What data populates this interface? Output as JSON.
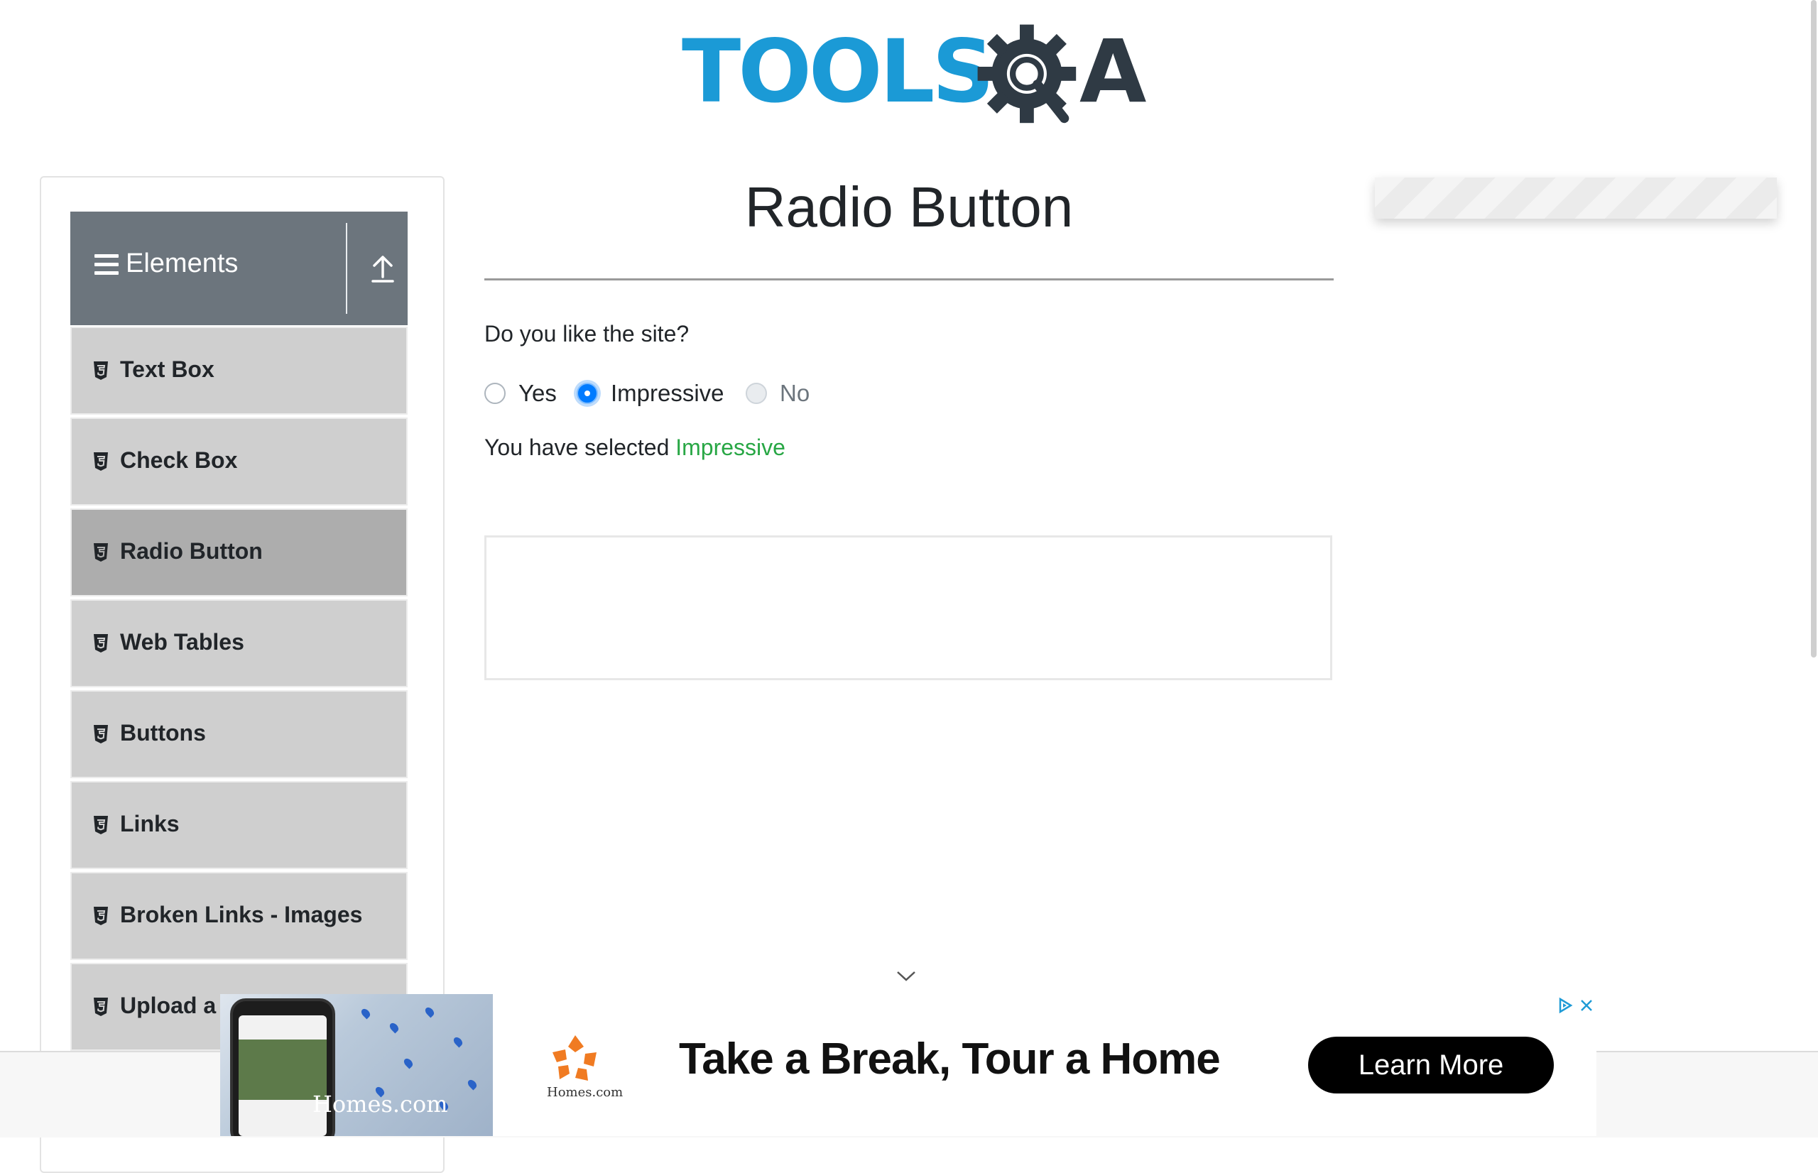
{
  "logo": {
    "part1": "TOOLS",
    "part2": "A"
  },
  "sidebar": {
    "group_title": "Elements",
    "items": [
      {
        "label": "Text Box"
      },
      {
        "label": "Check Box"
      },
      {
        "label": "Radio Button",
        "active": true
      },
      {
        "label": "Web Tables"
      },
      {
        "label": "Buttons"
      },
      {
        "label": "Links"
      },
      {
        "label": "Broken Links - Images"
      },
      {
        "label": "Upload a"
      }
    ]
  },
  "main": {
    "page_title": "Radio Button",
    "question": "Do you like the site?",
    "options": [
      {
        "label": "Yes",
        "checked": false,
        "disabled": false
      },
      {
        "label": "Impressive",
        "checked": true,
        "disabled": false
      },
      {
        "label": "No",
        "checked": false,
        "disabled": true
      }
    ],
    "result_prefix": "You have selected",
    "result_value": "Impressive"
  },
  "ad": {
    "brand": "Homes.com",
    "logo_text": "Homes.com",
    "headline": "Take a Break, Tour a Home",
    "cta": "Learn More"
  },
  "colors": {
    "logo_blue": "#1b9ad6",
    "logo_dark": "#2f3a44",
    "sidebar_header": "#6c757d",
    "menu_item": "#cfcfcf",
    "menu_item_active": "#adadad",
    "success_green": "#28a745",
    "radio_checked": "#007bff",
    "ad_accent": "#f07b22"
  },
  "icons": {
    "menu": "hamburger-icon",
    "collapse": "upload-arrow-icon",
    "item": "html5-icon",
    "scroll": "chevron-down-icon",
    "ad_choices": "adchoices-icon",
    "ad_close": "close-icon"
  }
}
